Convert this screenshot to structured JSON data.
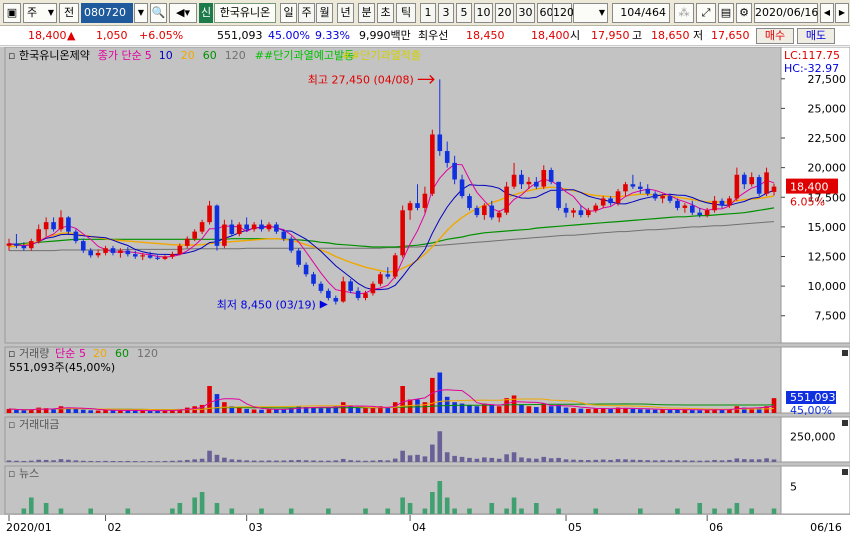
{
  "toolbar": {
    "market_select": "주",
    "prefix_label": "전",
    "code_value": "080720",
    "new_badge": "신",
    "stock_name": "한국유니온",
    "periods": [
      "일",
      "주",
      "월",
      "년",
      "분",
      "초",
      "틱"
    ],
    "active_period": "일",
    "intervals": [
      "1",
      "3",
      "5",
      "10",
      "20",
      "30",
      "60",
      "120"
    ],
    "page_counter": "104",
    "page_total": "/464",
    "date_value": "2020/06/16"
  },
  "quote": {
    "price": "18,400",
    "change_arrow": "▲",
    "change": "1,050",
    "change_pct": "+6.05%",
    "volume": "551,093",
    "volume_ratio": "45.00%",
    "turnover": "9.33%",
    "trade_value": "9,990백만",
    "best_label": "최우선",
    "best_ask": "18,450",
    "best_bid": "18,400",
    "open_label": "시",
    "open": "17,950",
    "high_label": "고",
    "high": "18,650",
    "low_label": "저",
    "low": "17,650",
    "buy_label": "매수",
    "sell_label": "매도"
  },
  "colors": {
    "up": "#e00000",
    "down": "#1030e0",
    "ma5": "#e000a0",
    "ma10": "#0000c0",
    "ma20": "#f0a800",
    "ma60": "#009000",
    "ma120": "#707070",
    "warn": "#00c000",
    "overheat": "#d0d000"
  },
  "chart_data": {
    "type": "candlestick",
    "title": "한국유니온제약",
    "legend_prefix": "종가 단순",
    "ma_periods": [
      "5",
      "10",
      "20",
      "60",
      "120"
    ],
    "signal_labels": [
      "##단기과열예고발동",
      "##단기과열적출"
    ],
    "lc_label": "LC:117.75",
    "hc_label": "HC:-32.97",
    "price_ticks": [
      "27,500",
      "25,000",
      "22,500",
      "20,000",
      "17,500",
      "15,000",
      "12,500",
      "10,000",
      "7,500"
    ],
    "current_price": "18,400",
    "current_pct": "6.05%",
    "high_annot": "최고 27,450 (04/08)",
    "low_annot": "최저 8,450 (03/19)",
    "ylim": [
      5200,
      29000
    ],
    "candles": [
      [
        13400,
        14000,
        13000,
        13600
      ],
      [
        13600,
        14400,
        13200,
        13400
      ],
      [
        13400,
        13700,
        13000,
        13200
      ],
      [
        13200,
        14000,
        13000,
        13800
      ],
      [
        13800,
        15200,
        13600,
        14800
      ],
      [
        14800,
        15800,
        14200,
        15400
      ],
      [
        15400,
        15800,
        14600,
        14800
      ],
      [
        14800,
        16400,
        14600,
        15800
      ],
      [
        15800,
        15900,
        14400,
        14600
      ],
      [
        14600,
        14800,
        13600,
        13800
      ],
      [
        13800,
        14000,
        12800,
        13000
      ],
      [
        13000,
        13200,
        12400,
        12600
      ],
      [
        12600,
        13100,
        12400,
        12800
      ],
      [
        12800,
        13400,
        12600,
        13200
      ],
      [
        13200,
        13400,
        12600,
        12800
      ],
      [
        12800,
        13200,
        12400,
        13000
      ],
      [
        13000,
        13300,
        12500,
        12700
      ],
      [
        12700,
        13000,
        12300,
        12500
      ],
      [
        12500,
        12800,
        12200,
        12600
      ],
      [
        12600,
        12900,
        12300,
        12400
      ],
      [
        12400,
        12600,
        12200,
        12300
      ],
      [
        12300,
        12600,
        12200,
        12500
      ],
      [
        12500,
        12900,
        12300,
        12700
      ],
      [
        12700,
        13600,
        12600,
        13400
      ],
      [
        13400,
        14200,
        13200,
        14000
      ],
      [
        14000,
        14800,
        13800,
        14600
      ],
      [
        14600,
        15600,
        14400,
        15400
      ],
      [
        15400,
        17200,
        15200,
        16800
      ],
      [
        16800,
        16900,
        13000,
        13400
      ],
      [
        13400,
        15600,
        13200,
        15200
      ],
      [
        15200,
        15600,
        14200,
        14400
      ],
      [
        14400,
        15400,
        14200,
        15200
      ],
      [
        15200,
        15800,
        14600,
        14800
      ],
      [
        14800,
        15400,
        14600,
        15200
      ],
      [
        15200,
        15600,
        14600,
        14800
      ],
      [
        14800,
        15400,
        14600,
        15200
      ],
      [
        15200,
        15400,
        14400,
        14600
      ],
      [
        14600,
        14800,
        13800,
        14000
      ],
      [
        14000,
        14200,
        12800,
        13000
      ],
      [
        13000,
        13200,
        11600,
        11800
      ],
      [
        11800,
        12000,
        10800,
        11000
      ],
      [
        11000,
        11200,
        10000,
        10200
      ],
      [
        10200,
        10400,
        9400,
        9600
      ],
      [
        9600,
        9800,
        8800,
        9000
      ],
      [
        9000,
        9200,
        8450,
        8700
      ],
      [
        8700,
        10800,
        8600,
        10400
      ],
      [
        10400,
        10600,
        9400,
        9600
      ],
      [
        9600,
        9900,
        8800,
        9000
      ],
      [
        9000,
        9600,
        8800,
        9400
      ],
      [
        9400,
        10400,
        9200,
        10200
      ],
      [
        10200,
        11200,
        10000,
        11000
      ],
      [
        11000,
        11600,
        10600,
        10800
      ],
      [
        10800,
        12800,
        10600,
        12600
      ],
      [
        12600,
        16800,
        12400,
        16400
      ],
      [
        16400,
        17200,
        15600,
        17000
      ],
      [
        17000,
        18600,
        16400,
        16600
      ],
      [
        16600,
        18400,
        16200,
        17800
      ],
      [
        17800,
        23200,
        17600,
        22800
      ],
      [
        22800,
        27450,
        21000,
        21400
      ],
      [
        21400,
        22200,
        20000,
        20400
      ],
      [
        20400,
        21000,
        18600,
        19000
      ],
      [
        19000,
        19400,
        17400,
        17600
      ],
      [
        17600,
        17800,
        16400,
        16600
      ],
      [
        16600,
        16800,
        15800,
        16000
      ],
      [
        16000,
        17000,
        15600,
        16800
      ],
      [
        16800,
        17200,
        15600,
        15800
      ],
      [
        15800,
        16400,
        15400,
        16200
      ],
      [
        16200,
        18800,
        16000,
        18400
      ],
      [
        18400,
        20400,
        18200,
        19400
      ],
      [
        19400,
        19800,
        18200,
        18600
      ],
      [
        18600,
        19200,
        18200,
        18800
      ],
      [
        18800,
        19200,
        18200,
        18400
      ],
      [
        18400,
        20200,
        18200,
        19800
      ],
      [
        19800,
        20000,
        18600,
        18800
      ],
      [
        18800,
        18800,
        16400,
        16600
      ],
      [
        16600,
        17000,
        15800,
        16200
      ],
      [
        16200,
        16600,
        15800,
        16400
      ],
      [
        16400,
        16800,
        15800,
        16000
      ],
      [
        16000,
        16600,
        15800,
        16400
      ],
      [
        16400,
        17000,
        16200,
        16800
      ],
      [
        16800,
        17600,
        16600,
        17400
      ],
      [
        17400,
        17600,
        16800,
        17000
      ],
      [
        17000,
        18200,
        16800,
        18000
      ],
      [
        18000,
        18800,
        17600,
        18600
      ],
      [
        18600,
        19400,
        18200,
        18400
      ],
      [
        18400,
        18800,
        17800,
        18200
      ],
      [
        18200,
        18600,
        17600,
        17800
      ],
      [
        17800,
        18000,
        17200,
        17400
      ],
      [
        17400,
        17800,
        17000,
        17600
      ],
      [
        17600,
        17800,
        17000,
        17200
      ],
      [
        17200,
        17400,
        16400,
        16600
      ],
      [
        16600,
        17000,
        16200,
        16800
      ],
      [
        16800,
        17200,
        16000,
        16200
      ],
      [
        16200,
        16600,
        15800,
        16000
      ],
      [
        16000,
        16600,
        15800,
        16400
      ],
      [
        16400,
        17600,
        16200,
        17200
      ],
      [
        17200,
        17400,
        16600,
        16800
      ],
      [
        16800,
        17600,
        16600,
        17400
      ],
      [
        17400,
        20000,
        17200,
        19400
      ],
      [
        19400,
        19600,
        18200,
        18600
      ],
      [
        18600,
        19600,
        18400,
        19200
      ],
      [
        19200,
        19400,
        17600,
        17800
      ],
      [
        17800,
        20000,
        17600,
        19600
      ],
      [
        17950,
        18650,
        17650,
        18400
      ]
    ],
    "ma_values": {
      "ma20": [
        13300,
        13400,
        13500,
        13600,
        13800,
        14100,
        14300,
        14450,
        14500,
        14400,
        14300,
        14200,
        14100,
        14000,
        13900,
        13850,
        13800,
        13750,
        13700,
        13650,
        13600,
        13550,
        13500,
        13480,
        13470,
        13470,
        13500,
        13600,
        13650,
        13700,
        13750,
        13800,
        13850,
        13900,
        13950,
        14000,
        14000,
        13950,
        13850,
        13700,
        13500,
        13300,
        13050,
        12800,
        12500,
        12250,
        12000,
        11800,
        11600,
        11450,
        11300,
        11200,
        11250,
        11500,
        11800,
        12200,
        12700,
        13300,
        14000,
        14700,
        15300,
        15800,
        16200,
        16550,
        16800,
        17050,
        17250,
        17500,
        17700,
        17900,
        18050,
        18200,
        18300,
        18350,
        18300,
        18200,
        18050,
        17900,
        17750,
        17650,
        17600,
        17550,
        17550,
        17600,
        17700,
        17750,
        17750,
        17700,
        17650,
        17600,
        17500,
        17400,
        17300,
        17200,
        17100,
        17100,
        17100,
        17100,
        17200,
        17300,
        17350,
        17400,
        17500,
        17600
      ],
      "ma60": [
        13500,
        13550,
        13600,
        13650,
        13700,
        13750,
        13800,
        13850,
        13900,
        13950,
        13950,
        13950,
        13950,
        13950,
        13950,
        13950,
        13950,
        13950,
        13950,
        13950,
        13950,
        13950,
        13950,
        13950,
        13950,
        13950,
        13950,
        13950,
        13950,
        13950,
        14000,
        14000,
        14000,
        14000,
        14000,
        14000,
        14000,
        13950,
        13950,
        13900,
        13850,
        13800,
        13700,
        13650,
        13550,
        13500,
        13450,
        13400,
        13350,
        13300,
        13300,
        13300,
        13300,
        13350,
        13400,
        13450,
        13550,
        13650,
        13800,
        13950,
        14050,
        14150,
        14300,
        14400,
        14500,
        14550,
        14600,
        14650,
        14700,
        14750,
        14800,
        14900,
        14950,
        15000,
        15050,
        15100,
        15150,
        15200,
        15250,
        15300,
        15350,
        15400,
        15450,
        15500,
        15550,
        15600,
        15650,
        15700,
        15750,
        15800,
        15850,
        15850,
        15900,
        15950,
        15950,
        16000,
        16050,
        16100,
        16150,
        16200,
        16300,
        16400,
        16500,
        16600
      ],
      "ma120": [
        13000,
        13000,
        13000,
        13000,
        13000,
        13000,
        13000,
        13050,
        13050,
        13050,
        13050,
        13050,
        13050,
        13050,
        13050,
        13050,
        13100,
        13100,
        13100,
        13100,
        13100,
        13100,
        13100,
        13100,
        13150,
        13150,
        13150,
        13150,
        13150,
        13150,
        13150,
        13150,
        13200,
        13200,
        13200,
        13200,
        13200,
        13200,
        13200,
        13200,
        13200,
        13200,
        13200,
        13200,
        13200,
        13200,
        13200,
        13200,
        13200,
        13200,
        13200,
        13250,
        13250,
        13250,
        13300,
        13300,
        13350,
        13400,
        13450,
        13500,
        13550,
        13600,
        13650,
        13700,
        13750,
        13800,
        13850,
        13900,
        13950,
        14000,
        14050,
        14100,
        14150,
        14200,
        14250,
        14300,
        14300,
        14350,
        14400,
        14450,
        14500,
        14550,
        14600,
        14600,
        14650,
        14700,
        14750,
        14750,
        14800,
        14850,
        14900,
        14950,
        15000,
        15000,
        15050,
        15100,
        15100,
        15150,
        15200,
        15250,
        15300,
        15350,
        15400,
        15450
      ]
    },
    "volume_title": "거래량",
    "volume_legend_prefix": "단순",
    "volume_ma_periods": [
      "5",
      "20",
      "60",
      "120"
    ],
    "volume_info": "551,093주(45,00%)",
    "volume_current": "551,093",
    "volume_pct": "45,00%",
    "volume_max": 2000000,
    "volumes": [
      150000,
      120000,
      100000,
      130000,
      200000,
      180000,
      150000,
      250000,
      200000,
      150000,
      120000,
      100000,
      90000,
      110000,
      100000,
      90000,
      100000,
      90000,
      80000,
      90000,
      80000,
      100000,
      120000,
      150000,
      200000,
      250000,
      300000,
      1000000,
      700000,
      400000,
      250000,
      200000,
      150000,
      130000,
      120000,
      140000,
      130000,
      150000,
      200000,
      250000,
      220000,
      200000,
      180000,
      200000,
      250000,
      400000,
      250000,
      200000,
      180000,
      200000,
      250000,
      200000,
      400000,
      1000000,
      500000,
      500000,
      400000,
      1300000,
      1500000,
      600000,
      400000,
      350000,
      300000,
      250000,
      350000,
      300000,
      250000,
      550000,
      650000,
      300000,
      250000,
      220000,
      350000,
      250000,
      300000,
      200000,
      180000,
      160000,
      150000,
      160000,
      180000,
      150000,
      200000,
      180000,
      150000,
      140000,
      130000,
      120000,
      130000,
      120000,
      140000,
      120000,
      110000,
      100000,
      110000,
      150000,
      120000,
      150000,
      250000,
      200000,
      180000,
      180000,
      250000,
      551093
    ],
    "value_title": "거래대금",
    "value_tick": "250,000",
    "value_max": 400000,
    "values": [
      15000,
      12000,
      10000,
      13000,
      22000,
      20000,
      17000,
      28000,
      22000,
      16000,
      12000,
      10000,
      9000,
      11000,
      10000,
      9000,
      10000,
      9000,
      8000,
      9000,
      8000,
      10000,
      12000,
      15000,
      20000,
      26000,
      32000,
      110000,
      70000,
      42000,
      26000,
      22000,
      16000,
      14000,
      13000,
      15000,
      14000,
      15000,
      18000,
      20000,
      17000,
      15000,
      13000,
      13000,
      16000,
      30000,
      18000,
      14000,
      12000,
      14000,
      19000,
      16000,
      33000,
      110000,
      65000,
      70000,
      55000,
      170000,
      300000,
      95000,
      60000,
      50000,
      40000,
      32000,
      45000,
      40000,
      32000,
      75000,
      95000,
      45000,
      36000,
      32000,
      50000,
      36000,
      40000,
      26000,
      23000,
      20000,
      19000,
      21000,
      24000,
      20000,
      28000,
      26000,
      22000,
      20000,
      18000,
      16000,
      18000,
      16000,
      18000,
      16000,
      14000,
      13000,
      14000,
      20000,
      16000,
      20000,
      35000,
      28000,
      26000,
      26000,
      36000,
      25000
    ],
    "news_title": "뉴스",
    "news_tick": "5",
    "news_max": 8,
    "news": [
      0,
      0,
      1,
      3,
      0,
      2,
      0,
      1,
      0,
      0,
      0,
      1,
      0,
      0,
      0,
      0,
      1,
      0,
      0,
      0,
      0,
      0,
      1,
      2,
      0,
      3,
      4,
      0,
      2,
      0,
      1,
      0,
      0,
      0,
      1,
      0,
      0,
      0,
      1,
      0,
      0,
      0,
      0,
      1,
      0,
      0,
      0,
      0,
      1,
      0,
      0,
      1,
      0,
      3,
      2,
      0,
      1,
      4,
      6,
      3,
      1,
      0,
      1,
      0,
      0,
      2,
      0,
      1,
      3,
      1,
      0,
      2,
      0,
      0,
      1,
      0,
      0,
      0,
      0,
      1,
      0,
      0,
      0,
      0,
      0,
      1,
      0,
      0,
      0,
      0,
      1,
      0,
      0,
      2,
      0,
      1,
      0,
      1,
      2,
      0,
      1,
      0,
      0,
      1
    ],
    "x_labels": [
      {
        "label": "2020/01",
        "index": 0
      },
      {
        "label": "02",
        "index": 13
      },
      {
        "label": "03",
        "index": 32
      },
      {
        "label": "04",
        "index": 54
      },
      {
        "label": "05",
        "index": 75
      },
      {
        "label": "06",
        "index": 94
      }
    ],
    "x_end_label": "06/16"
  }
}
